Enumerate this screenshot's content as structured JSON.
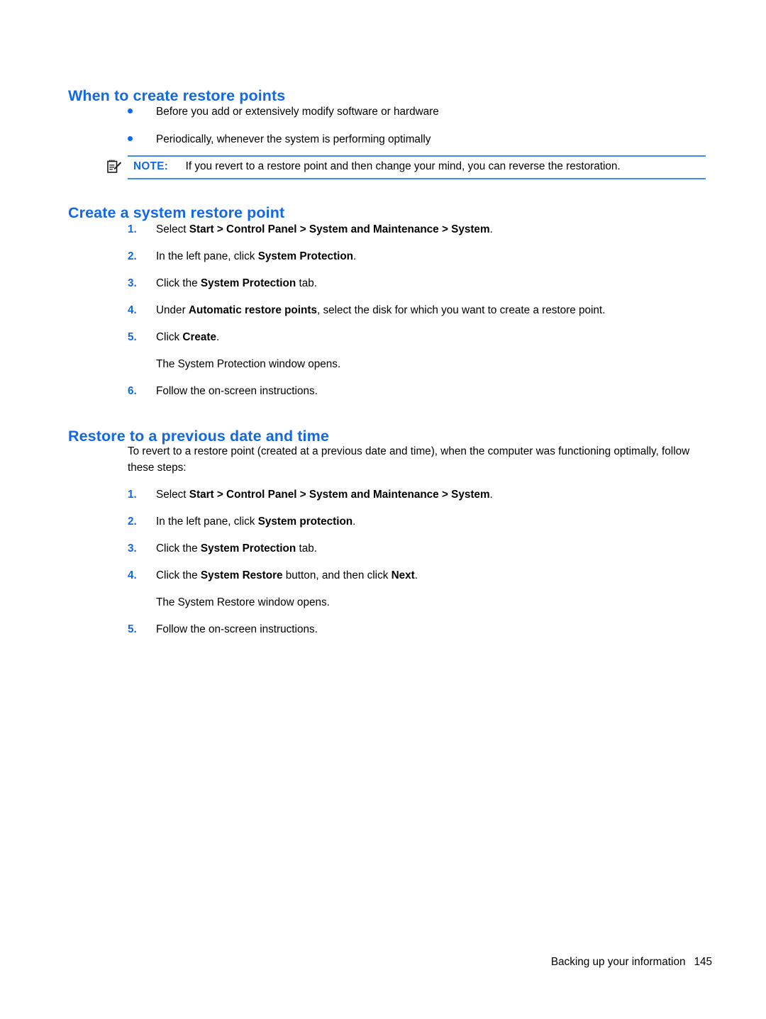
{
  "page": {
    "footer_title": "Backing up your information",
    "footer_page_number": "145",
    "accent_blue": "#1269e8",
    "rule_blue": "#3b8ef0"
  },
  "sections": [
    {
      "heading": "When to create restore points",
      "bullets": [
        "Before you add or extensively modify software or hardware",
        "Periodically, whenever the system is performing optimally"
      ]
    },
    {
      "heading": "Create a system restore point"
    },
    {
      "heading": "Restore to a previous date and time",
      "intro": "To revert to a restore point (created at a previous date and time), when the computer was functioning optimally, follow these steps:"
    }
  ],
  "note": {
    "icon": "note-pencil-icon",
    "label": "NOTE:",
    "text": "If you revert to a restore point and then change your mind, you can reverse the restoration."
  },
  "create_steps": [
    {
      "num": "1.",
      "prefix": "Select ",
      "bold": "Start > Control Panel > System and Maintenance > System",
      "suffix": "."
    },
    {
      "num": "2.",
      "prefix": "In the left pane, click ",
      "bold": "System Protection",
      "suffix": "."
    },
    {
      "num": "3.",
      "prefix": "Click the ",
      "bold": "System Protection",
      "suffix": " tab."
    },
    {
      "num": "4.",
      "prefix": "Under ",
      "bold": "Automatic restore points",
      "suffix": ", select the disk for which you want to create a restore point."
    },
    {
      "num": "5.",
      "prefix": "Click ",
      "bold": "Create",
      "suffix": "."
    },
    {
      "num": "6.",
      "prefix": "Follow the on-screen instructions.",
      "bold": "",
      "suffix": ""
    }
  ],
  "create_result": "The System Protection window opens.",
  "restore_steps": [
    {
      "num": "1.",
      "prefix": "Select ",
      "bold": "Start > Control Panel > System and Maintenance > System",
      "suffix": "."
    },
    {
      "num": "2.",
      "prefix": "In the left pane, click ",
      "bold": "System protection",
      "suffix": "."
    },
    {
      "num": "3.",
      "prefix": "Click the ",
      "bold": "System Protection",
      "suffix": " tab."
    },
    {
      "num": "4.",
      "prefix": "Click the ",
      "bold": "System Restore",
      "suffix": " button, and then click ",
      "bold2": "Next",
      "suffix2": "."
    },
    {
      "num": "5.",
      "prefix": "Follow the on-screen instructions.",
      "bold": "",
      "suffix": ""
    }
  ],
  "restore_result": "The System Restore window opens."
}
